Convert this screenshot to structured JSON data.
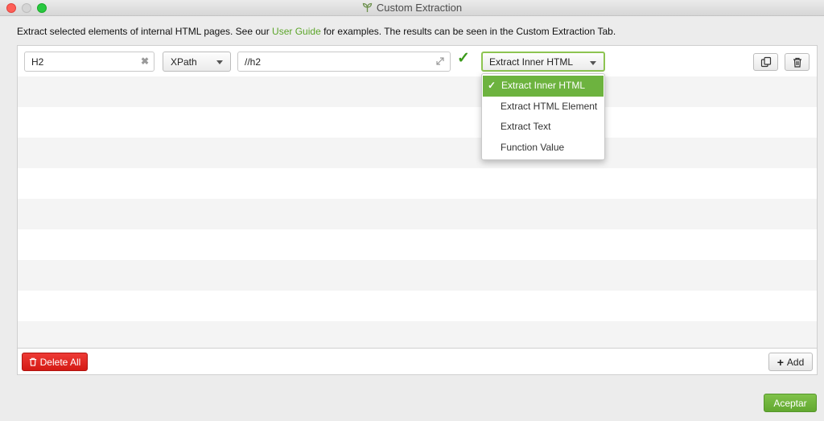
{
  "window": {
    "title": "Custom Extraction"
  },
  "intro": {
    "before": "Extract selected elements of internal HTML pages. See our ",
    "link": "User Guide",
    "after": " for examples. The results can be seen in the Custom Extraction Tab."
  },
  "extractor": {
    "name_value": "H2",
    "type_value": "XPath",
    "expression_value": "//h2",
    "valid_mark": "✓",
    "extract_mode_value": "Extract Inner HTML"
  },
  "dropdown": {
    "options": [
      "Extract Inner HTML",
      "Extract HTML Element",
      "Extract Text",
      "Function Value"
    ],
    "selected_index": 0,
    "selected_mark": "✓"
  },
  "buttons": {
    "delete_all": "Delete All",
    "add": "Add",
    "ok": "Aceptar"
  },
  "colors": {
    "accent_green": "#6db33f",
    "link_green": "#5ca52a",
    "delete_red": "#e2231a"
  },
  "icons": {
    "clear": "clear-icon",
    "expand": "expand-icon",
    "duplicate": "duplicate-icon",
    "delete": "trash-icon",
    "add": "plus-icon"
  }
}
